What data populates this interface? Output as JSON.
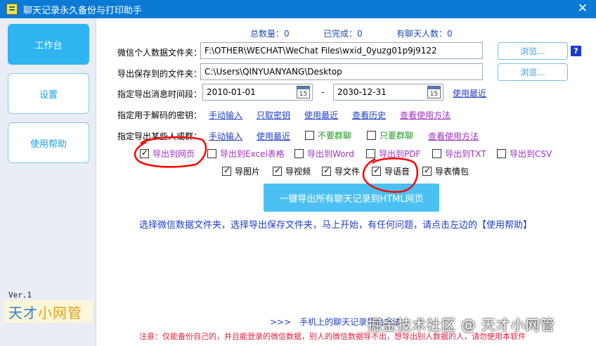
{
  "window": {
    "title": "聊天记录永久备份与打印助手",
    "close_glyph": "✕"
  },
  "sidebar": {
    "items": [
      {
        "label": "工作台",
        "active": true
      },
      {
        "label": "设置",
        "active": false
      },
      {
        "label": "使用帮助",
        "active": false
      }
    ],
    "version": "Ver.1",
    "brand_part1": "天才",
    "brand_part2": "小网管"
  },
  "stats": {
    "total": "总数量：0",
    "done": "已完成：0",
    "chat_count": "有聊天人数：0"
  },
  "form": {
    "wechat_dir_label": "微信个人数据文件夹：",
    "wechat_dir_value": "F:\\OTHER\\WECHAT\\WeChat Files\\wxid_0yuzg01p9j9122",
    "save_dir_label": "导出保存到的文件夹：",
    "save_dir_value": "C:\\Users\\QINYUANYANG\\Desktop",
    "browse_label": "浏览...",
    "help_q": "?",
    "time_label": "指定导出消息时间段：",
    "date_from": "2010-01-01",
    "date_to": "2030-12-31",
    "date_sep": "-",
    "cal_day": "15",
    "use_recent": "使用最近",
    "key_label": "指定用于解码的密钥：",
    "key_manual": "手动输入",
    "key_fetch": "只取密钥",
    "key_recent": "使用最近",
    "key_history": "查看历史",
    "key_howto": "查看使用方法",
    "contacts_label": "指定导出某些人或群：",
    "contacts_manual": "手动输入",
    "contacts_recent": "使用最近",
    "no_group": "不要群聊",
    "only_group": "只要群聊",
    "contacts_howto": "查看使用方法"
  },
  "export_formats": [
    {
      "label": "导出到网页",
      "checked": true
    },
    {
      "label": "导出到Excel表格",
      "checked": false
    },
    {
      "label": "导出到Word",
      "checked": false
    },
    {
      "label": "导出到PDF",
      "checked": false
    },
    {
      "label": "导出到TXT",
      "checked": false
    },
    {
      "label": "导出到CSV",
      "checked": false
    }
  ],
  "media_options": [
    {
      "label": "导图片",
      "checked": true
    },
    {
      "label": "导视频",
      "checked": true
    },
    {
      "label": "导文件",
      "checked": true
    },
    {
      "label": "导语音",
      "checked": true
    },
    {
      "label": "导表情包",
      "checked": true
    }
  ],
  "main_button": "一键导出所有聊天记录到HTML网页",
  "info": "选择微信数据文件夹，选择导出保存文件夹，马上开始，有任何问题，请点击左边的【使用帮助】",
  "mobile_link": ">>>　手机上的聊天记录导出方法",
  "notice": "注意：仅能备份自己的，并且能登录的微信数据，别人的微信数据导不出，想导出别人数据的人，请勿使用本软件",
  "watermark": "掘金技术社区 @ 天才小网管",
  "colors": {
    "titlebar": "#0a7ad4",
    "accent": "#2fb4f0",
    "annotation": "#ff0000"
  }
}
